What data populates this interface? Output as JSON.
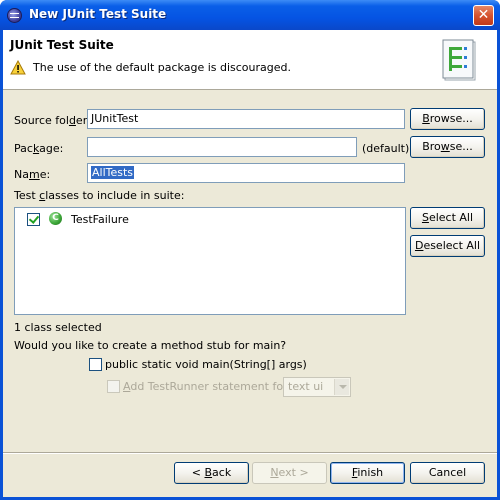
{
  "window": {
    "title": "New JUnit Test Suite",
    "close_glyph": "✕"
  },
  "banner": {
    "title": "JUnit Test Suite",
    "message": "The use of the default package is discouraged.",
    "message_icon": "warning-icon",
    "graphic_icon": "junit-suite-wizard-icon"
  },
  "form": {
    "source_folder": {
      "label_pre": "Source fol",
      "label_key": "d",
      "label_post": "er:",
      "value": "JUnitTest",
      "browse": {
        "pre": "",
        "key": "B",
        "post": "rowse..."
      }
    },
    "package": {
      "label_pre": "Pac",
      "label_key": "k",
      "label_post": "age:",
      "value": "",
      "hint": "(default)",
      "browse": {
        "pre": "Bro",
        "key": "w",
        "post": "se..."
      }
    },
    "name": {
      "label_pre": "Na",
      "label_key": "m",
      "label_post": "e:",
      "value": "AllTests"
    }
  },
  "suite": {
    "label_pre": "Test ",
    "label_key": "c",
    "label_post": "lasses to include in suite:",
    "classes": [
      {
        "name": "TestFailure",
        "checked": true,
        "icon": "java-class-icon",
        "icon_glyph": "C"
      }
    ],
    "select_all": {
      "pre": "",
      "key": "S",
      "post": "elect All"
    },
    "deselect_all": {
      "pre": "",
      "key": "D",
      "post": "eselect All"
    },
    "status": "1 class selected"
  },
  "main_stub": {
    "question": "Would you like to create a method stub for main?",
    "option_label": "public static void main(String[] args)",
    "option_checked": false,
    "testrunner_pre": "",
    "testrunner_key": "A",
    "testrunner_post": "dd TestRunner statement for:",
    "testrunner_checked": false,
    "testrunner_enabled": false,
    "testrunner_selected": "text ui"
  },
  "footer": {
    "back": {
      "pre": "< ",
      "key": "B",
      "post": "ack"
    },
    "next": {
      "pre": "",
      "key": "N",
      "post": "ext >"
    },
    "finish": {
      "pre": "",
      "key": "F",
      "post": "inish"
    },
    "cancel": "Cancel"
  },
  "colors": {
    "titlebar": "#0554e3",
    "dialog_face": "#ece9d8",
    "selection": "#316ac5",
    "button_border": "#003c74",
    "class_icon": "#3ea83a"
  }
}
